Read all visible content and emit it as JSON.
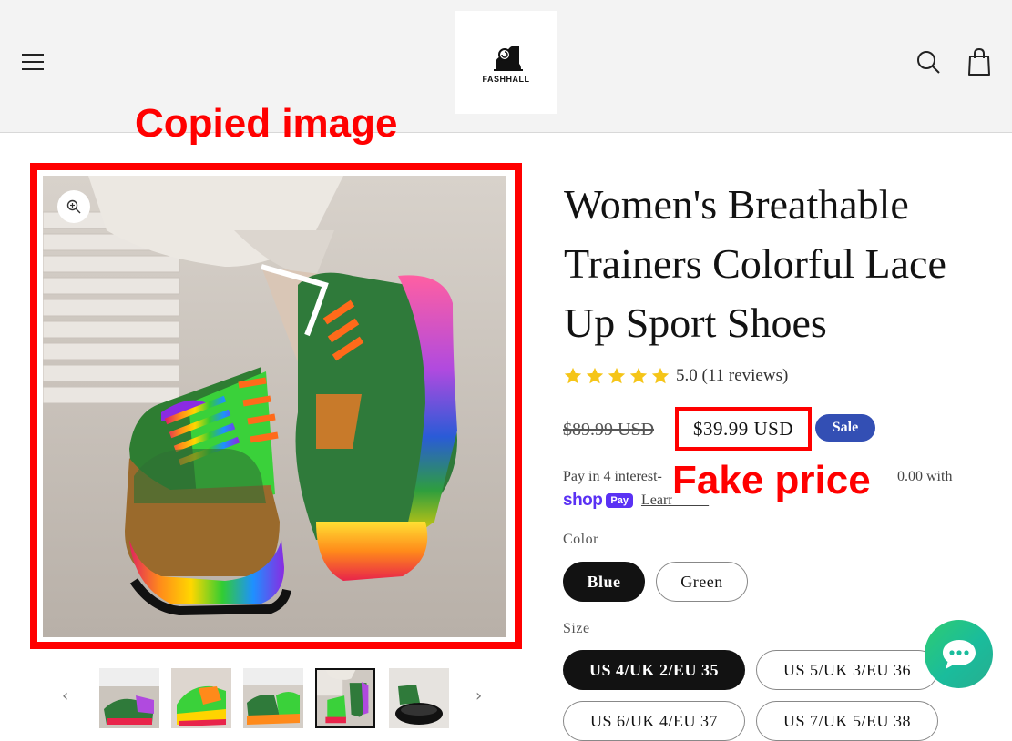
{
  "header": {
    "logo_text": "FASHHALL",
    "icons": {
      "menu": "hamburger-menu-icon",
      "search": "search-icon",
      "cart": "shopping-bag-icon"
    }
  },
  "annotations": {
    "copied_image": "Copied image",
    "fake_price": "Fake price",
    "color": "#ff0000"
  },
  "gallery": {
    "zoom_icon": "zoom-in-icon",
    "active_thumbnail": 4,
    "thumbnail_count": 5,
    "prev_arrow": "‹",
    "next_arrow": "›"
  },
  "product": {
    "title": "Women's Breathable Trainers Colorful Lace Up Sport Shoes",
    "rating_value": 5,
    "rating_text": "5.0 (11 reviews)",
    "price_regular": "$89.99 USD",
    "price_sale": "$39.99 USD",
    "sale_badge": "Sale",
    "installments_prefix": "Pay in 4 interest-",
    "installments_suffix": "0.00 with",
    "shop_pay_word": "shop",
    "shop_pay_pill": "Pay",
    "learn_more": "Learn more",
    "color_label": "Color",
    "colors": [
      "Blue",
      "Green"
    ],
    "selected_color": "Blue",
    "size_label": "Size",
    "sizes": [
      "US 4/UK 2/EU 35",
      "US 5/UK 3/EU 36",
      "US 6/UK 4/EU 37",
      "US 7/UK 5/EU 38"
    ],
    "selected_size": "US 4/UK 2/EU 35"
  },
  "colors": {
    "sale_badge": "#334fb4",
    "shop_pay": "#5a31f4",
    "star": "#f5c518",
    "chat": "#1abc9c"
  },
  "chat": {
    "icon": "chat-bubble-icon"
  }
}
